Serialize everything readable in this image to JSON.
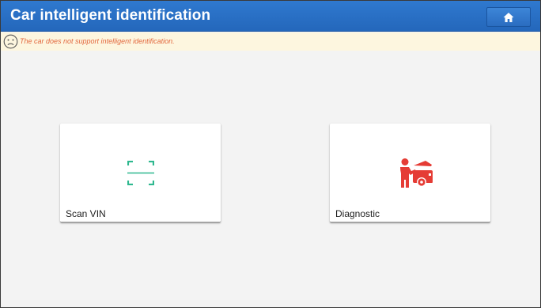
{
  "header": {
    "title": "Car intelligent identification",
    "home_icon": "home-icon"
  },
  "notice": {
    "icon": "sad-face-icon",
    "text": "The car does not support intelligent identification."
  },
  "cards": [
    {
      "label": "Scan VIN",
      "icon": "scan-frame-icon",
      "icon_color": "#2fb88f"
    },
    {
      "label": "Diagnostic",
      "icon": "mechanic-car-icon",
      "icon_color": "#e53c35"
    }
  ],
  "colors": {
    "header_bg": "#2a70c5",
    "notice_bg": "#fdf6df",
    "notice_text": "#e2673d",
    "page_bg": "#f3f3f3"
  }
}
